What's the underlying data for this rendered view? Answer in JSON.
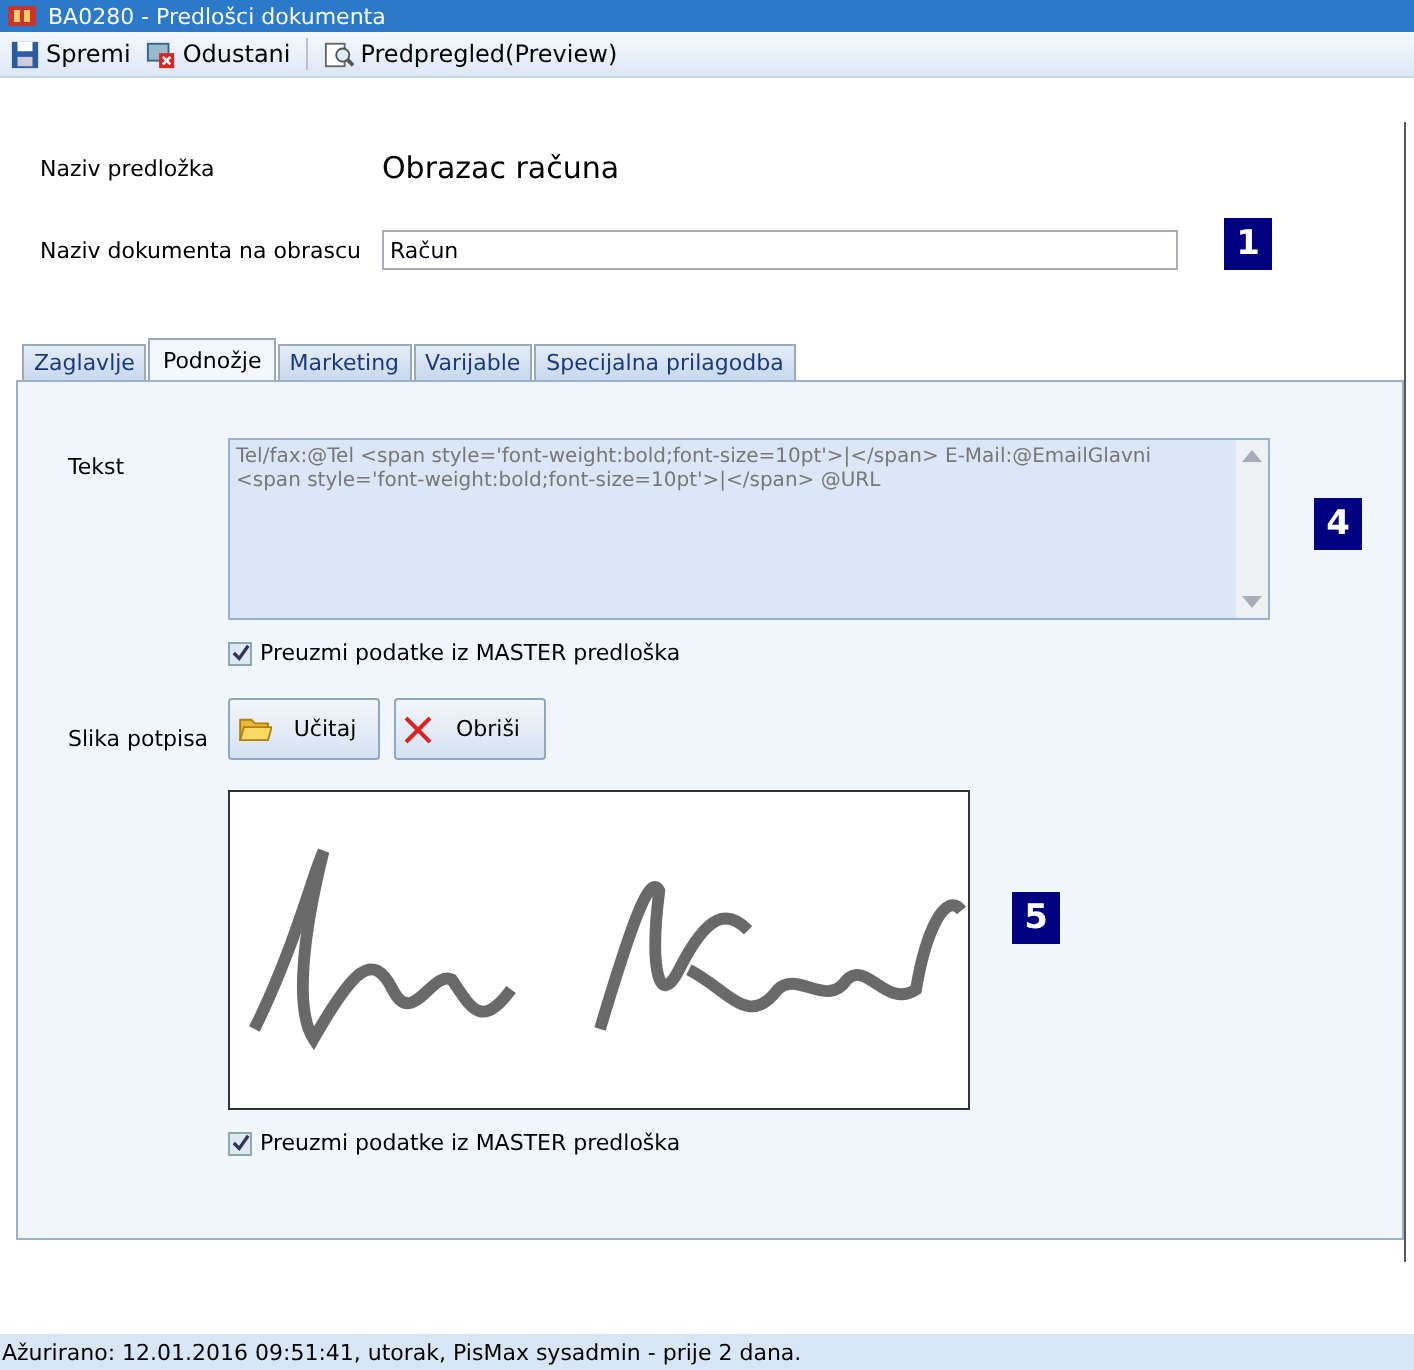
{
  "window": {
    "title": "BA0280 - Predlošci dokumenta"
  },
  "toolbar": [
    {
      "label": "Spremi",
      "kind": "save"
    },
    {
      "label": "Odustani",
      "kind": "cancel"
    },
    {
      "label": "Predpregled(Preview)",
      "kind": "preview"
    }
  ],
  "form": {
    "template_name_label": "Naziv predložka",
    "template_name": "Obrazac računa",
    "doc_name_label": "Naziv dokumenta na obrascu",
    "doc_name": "Račun"
  },
  "tabs": [
    {
      "label": "Zaglavlje",
      "selected": false
    },
    {
      "label": "Podnožje",
      "selected": true
    },
    {
      "label": "Marketing",
      "selected": false
    },
    {
      "label": "Varijable",
      "selected": false
    },
    {
      "label": "Specijalna prilagodba",
      "selected": false
    }
  ],
  "footer_tab": {
    "text_label": "Tekst",
    "text_value": "Tel/fax:@Tel <span style='font-weight:bold;font-size=10pt'>|</span> E-Mail:@EmailGlavni <span style='font-weight:bold;font-size=10pt'>|</span> @URL",
    "text_master": {
      "label": "Preuzmi podatke iz MASTER predloška",
      "checked": true
    },
    "signature_label": "Slika potpisa",
    "buttons": [
      {
        "label": "Učitaj",
        "kind": "load"
      },
      {
        "label": "Obriši",
        "kind": "delete"
      }
    ],
    "signature_master": {
      "label": "Preuzmi podatke iz MASTER predloška",
      "checked": true
    }
  },
  "callouts": [
    "1",
    "4",
    "5"
  ],
  "status_bar": "Ažurirano: 12.01.2016 09:51:41, utorak, PisMax sysadmin -  prije 2 dana."
}
